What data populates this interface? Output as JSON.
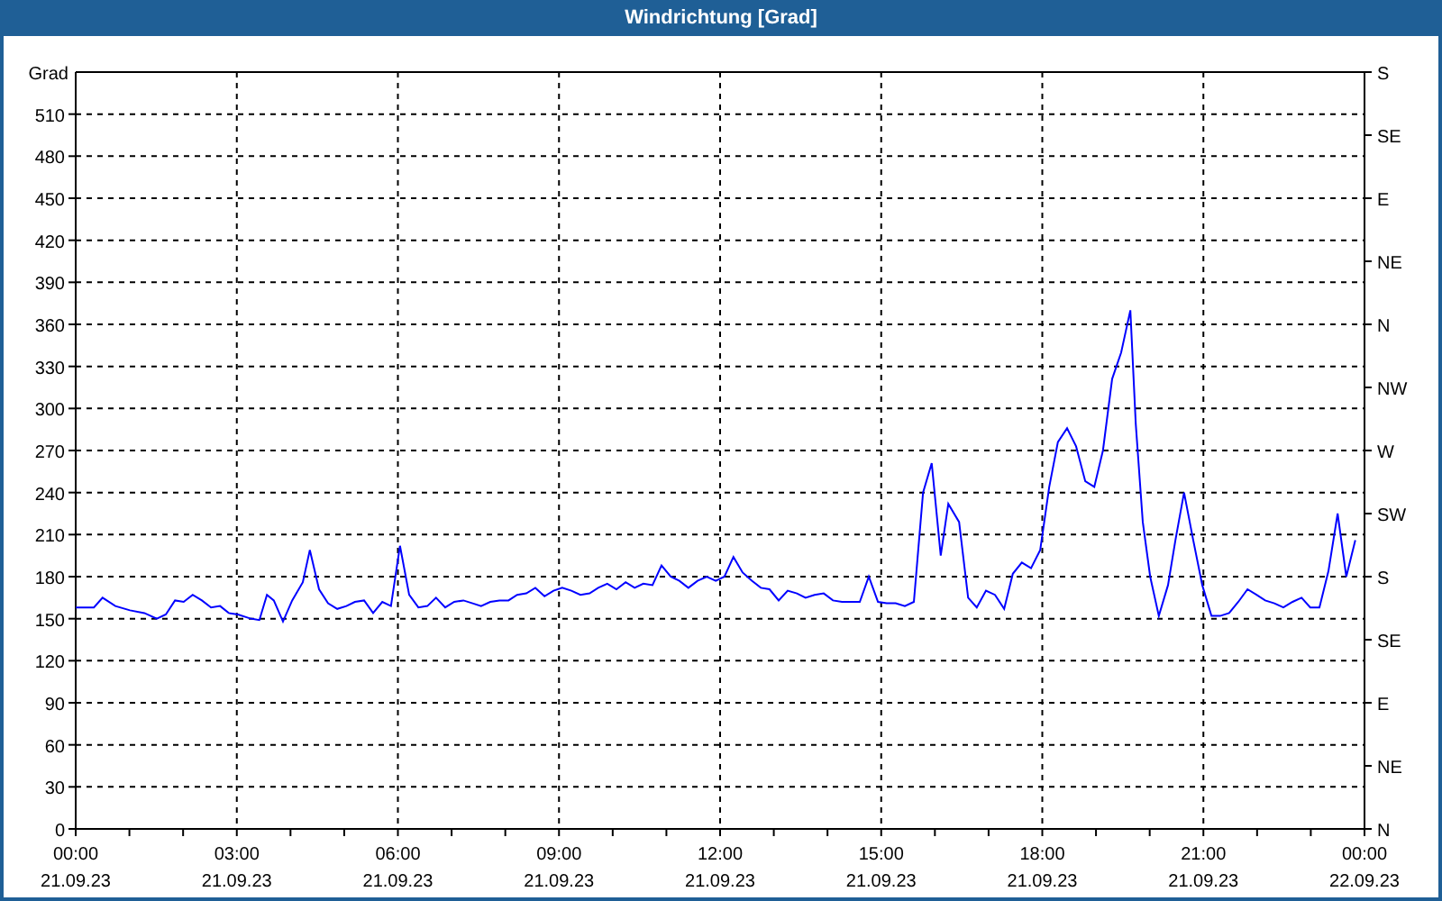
{
  "window": {
    "title": "Windrichtung [Grad]"
  },
  "chart": {
    "right_axis_labels": [
      "S",
      "SE",
      "E",
      "NE",
      "N",
      "NW",
      "W",
      "SW",
      "S",
      "SE",
      "E",
      "NE",
      "N"
    ],
    "x_dates": [
      "21.09.23",
      "21.09.23",
      "21.09.23",
      "21.09.23",
      "21.09.23",
      "21.09.23",
      "21.09.23",
      "21.09.23",
      "22.09.23"
    ],
    "chart_data": {
      "type": "line",
      "grid": true,
      "ylabel": "Grad",
      "xlim": [
        0,
        24
      ],
      "ylim": [
        0,
        540
      ],
      "yticks": [
        0,
        30,
        60,
        90,
        120,
        150,
        180,
        210,
        240,
        270,
        300,
        330,
        360,
        390,
        420,
        450,
        480,
        510
      ],
      "xticks": [
        {
          "value": 0,
          "label": "00:00"
        },
        {
          "value": 3,
          "label": "03:00"
        },
        {
          "value": 6,
          "label": "06:00"
        },
        {
          "value": 9,
          "label": "09:00"
        },
        {
          "value": 12,
          "label": "12:00"
        },
        {
          "value": 15,
          "label": "15:00"
        },
        {
          "value": 18,
          "label": "18:00"
        },
        {
          "value": 21,
          "label": "21:00"
        },
        {
          "value": 24,
          "label": "00:00"
        }
      ],
      "x": [
        0,
        0.34,
        0.5,
        0.74,
        1.01,
        1.28,
        1.51,
        1.68,
        1.85,
        2.01,
        2.18,
        2.35,
        2.52,
        2.69,
        2.85,
        3.02,
        3.26,
        3.42,
        3.56,
        3.69,
        3.86,
        4.03,
        4.23,
        4.36,
        4.53,
        4.7,
        4.87,
        5.04,
        5.2,
        5.37,
        5.54,
        5.71,
        5.87,
        6.04,
        6.21,
        6.38,
        6.55,
        6.71,
        6.88,
        7.05,
        7.22,
        7.39,
        7.55,
        7.72,
        7.89,
        8.06,
        8.22,
        8.39,
        8.56,
        8.73,
        8.9,
        9.06,
        9.23,
        9.4,
        9.57,
        9.73,
        9.9,
        10.07,
        10.24,
        10.41,
        10.57,
        10.74,
        10.91,
        11.08,
        11.24,
        11.41,
        11.58,
        11.75,
        11.92,
        12.08,
        12.25,
        12.42,
        12.59,
        12.76,
        12.92,
        13.09,
        13.26,
        13.43,
        13.59,
        13.76,
        13.93,
        14.1,
        14.27,
        14.43,
        14.6,
        14.77,
        14.94,
        15.1,
        15.27,
        15.44,
        15.61,
        15.78,
        15.94,
        16.11,
        16.25,
        16.45,
        16.62,
        16.78,
        16.95,
        17.12,
        17.29,
        17.45,
        17.62,
        17.79,
        17.96,
        18.13,
        18.29,
        18.46,
        18.63,
        18.8,
        18.97,
        19.13,
        19.3,
        19.47,
        19.64,
        19.74,
        19.87,
        20.01,
        20.17,
        20.34,
        20.48,
        20.64,
        20.81,
        20.98,
        21.15,
        21.31,
        21.48,
        21.65,
        21.82,
        21.99,
        22.15,
        22.32,
        22.49,
        22.66,
        22.83,
        22.99,
        23.16,
        23.33,
        23.5,
        23.66,
        23.83
      ],
      "series": [
        {
          "color": "#0000ff",
          "values": [
            158,
            158,
            165,
            159,
            156,
            154,
            150,
            153,
            163,
            162,
            167,
            163,
            158,
            159,
            154,
            153,
            150,
            149,
            167,
            163,
            148,
            163,
            176,
            199,
            171,
            161,
            157,
            159,
            162,
            163,
            154,
            162,
            159,
            202,
            167,
            158,
            159,
            165,
            158,
            162,
            163,
            161,
            159,
            162,
            163,
            163,
            167,
            168,
            172,
            166,
            170,
            172,
            170,
            167,
            168,
            172,
            175,
            171,
            176,
            172,
            175,
            174,
            188,
            180,
            177,
            172,
            177,
            180,
            177,
            180,
            194,
            183,
            177,
            172,
            171,
            163,
            170,
            168,
            165,
            167,
            168,
            163,
            162,
            162,
            162,
            180,
            162,
            161,
            161,
            159,
            162,
            240,
            261,
            195,
            232,
            219,
            165,
            158,
            170,
            167,
            157,
            182,
            190,
            186,
            199,
            244,
            276,
            286,
            273,
            248,
            244,
            270,
            321,
            340,
            370,
            289,
            219,
            180,
            152,
            174,
            206,
            240,
            206,
            174,
            152,
            152,
            154,
            162,
            171,
            167,
            163,
            161,
            158,
            162,
            165,
            158,
            158,
            184,
            225,
            180,
            206
          ]
        }
      ]
    }
  }
}
